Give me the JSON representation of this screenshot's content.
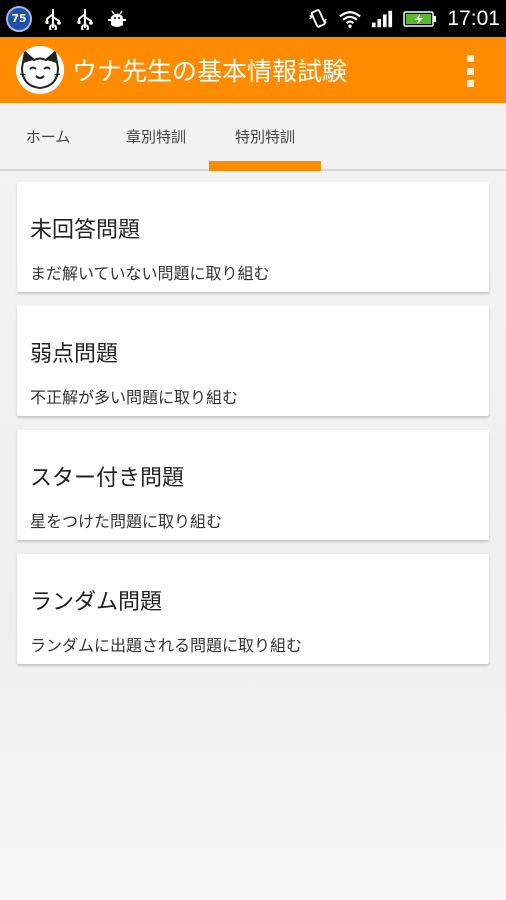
{
  "status_bar": {
    "battery_level": "75",
    "time": "17:01",
    "icons": [
      "usb-icon",
      "usb-icon",
      "android-debug-icon",
      "vibrate-icon",
      "wifi-icon",
      "signal-icon",
      "battery-charging-icon"
    ]
  },
  "app": {
    "title": "ウナ先生の基本情報試験",
    "accent_color": "#ff8c00"
  },
  "tabs": [
    {
      "label": "ホーム",
      "selected": false
    },
    {
      "label": "章別特訓",
      "selected": false
    },
    {
      "label": "特別特訓",
      "selected": true
    }
  ],
  "cards": [
    {
      "title": "未回答問題",
      "description": "まだ解いていない問題に取り組む"
    },
    {
      "title": "弱点問題",
      "description": "不正解が多い問題に取り組む"
    },
    {
      "title": "スター付き問題",
      "description": "星をつけた問題に取り組む"
    },
    {
      "title": "ランダム問題",
      "description": "ランダムに出題される問題に取り組む"
    }
  ]
}
